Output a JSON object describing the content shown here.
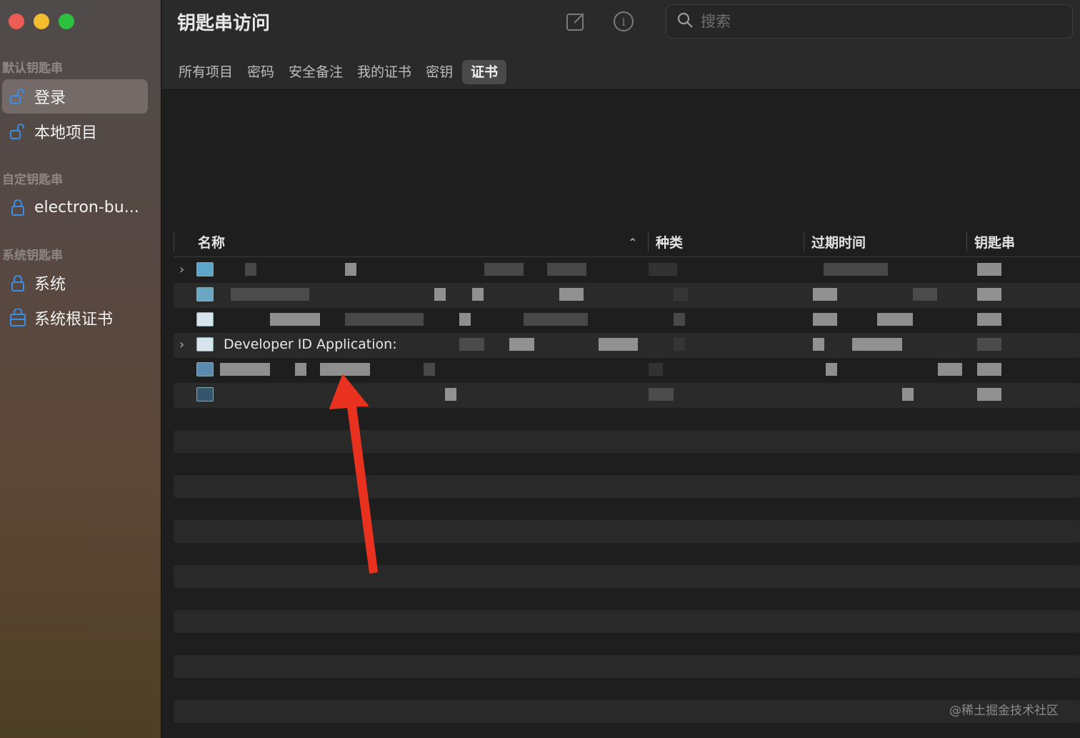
{
  "window": {
    "title": "钥匙串访问"
  },
  "sidebar": {
    "sections": [
      {
        "label": "默认钥匙串",
        "items": [
          {
            "label": "登录",
            "icon": "unlock-icon",
            "selected": true
          },
          {
            "label": "本地项目",
            "icon": "unlock-icon",
            "selected": false
          }
        ]
      },
      {
        "label": "自定钥匙串",
        "items": [
          {
            "label": "electron-bu...",
            "icon": "lock-icon",
            "selected": false
          }
        ]
      },
      {
        "label": "系统钥匙串",
        "items": [
          {
            "label": "系统",
            "icon": "lock-icon",
            "selected": false
          },
          {
            "label": "系统根证书",
            "icon": "cabinet-icon",
            "selected": false
          }
        ]
      }
    ]
  },
  "toolbar": {
    "search_placeholder": "搜索",
    "tabs": [
      "所有项目",
      "密码",
      "安全备注",
      "我的证书",
      "密钥",
      "证书"
    ],
    "active_tab": "证书"
  },
  "table": {
    "columns": [
      "名称",
      "种类",
      "过期时间",
      "钥匙串"
    ],
    "visible_row_text": "Developer ID Application:"
  },
  "watermark": "@稀土掘金技术社区",
  "colors": {
    "accent": "#2f7fd8",
    "arrow": "#e8321f"
  }
}
